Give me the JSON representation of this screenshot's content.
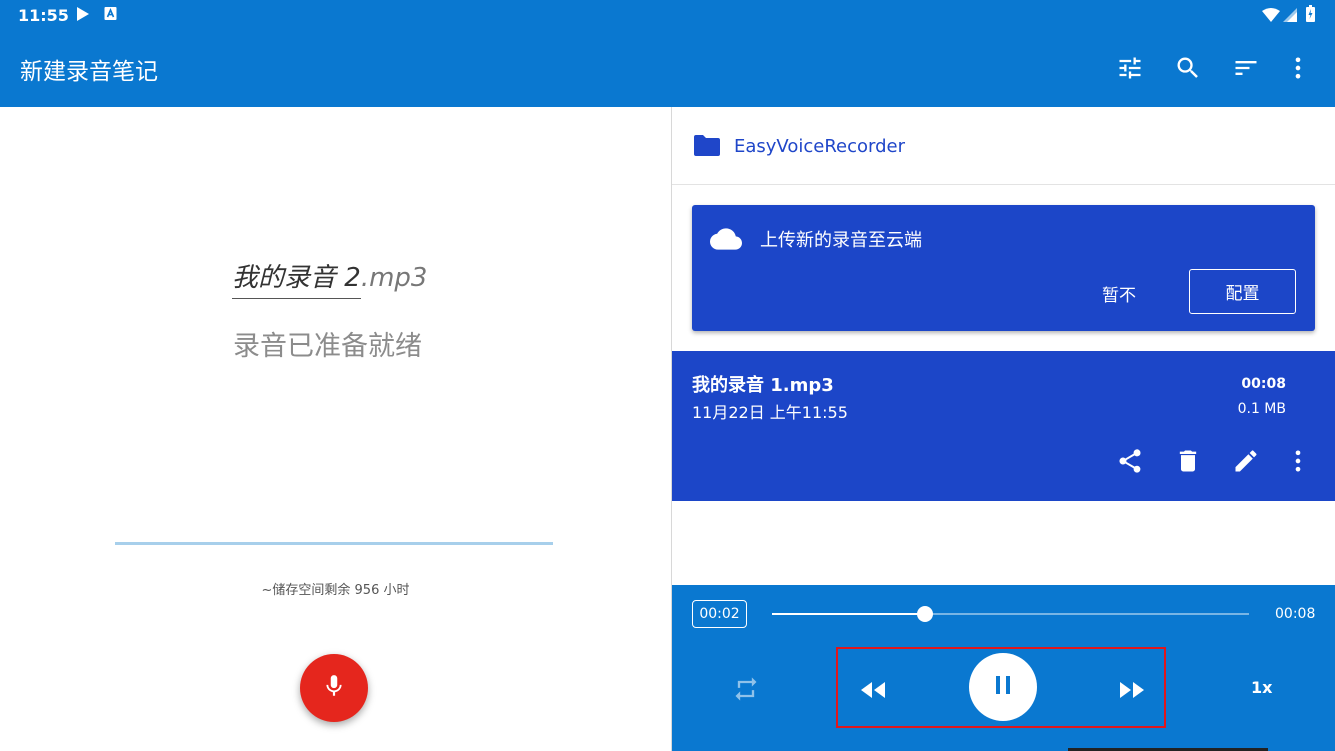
{
  "status_bar": {
    "time": "11:55",
    "icons": [
      "play-icon",
      "app-icon",
      "wifi-icon",
      "signal-icon",
      "battery-icon"
    ]
  },
  "app_bar": {
    "title": "新建录音笔记",
    "actions": [
      "tune-icon",
      "search-icon",
      "sort-icon",
      "more-vert-icon"
    ]
  },
  "recorder": {
    "file_base": "我的录音 2",
    "file_ext": ".mp3",
    "status": "录音已准备就绪",
    "storage": "~储存空间剩余 956 小时"
  },
  "folder": {
    "name": "EasyVoiceRecorder"
  },
  "cloud_card": {
    "message": "上传新的录音至云端",
    "later_label": "暂不",
    "config_label": "配置"
  },
  "recording": {
    "name": "我的录音 1.mp3",
    "date": "11月22日 上午11:55",
    "duration": "00:08",
    "size": "0.1 MB",
    "actions": [
      "share-icon",
      "delete-icon",
      "edit-icon",
      "more-vert-icon"
    ]
  },
  "player": {
    "current": "00:02",
    "total": "00:08",
    "progress_fraction": 0.32,
    "speed": "1x"
  },
  "colors": {
    "primary": "#0a78d0",
    "accent_dark": "#1c46c8",
    "record_red": "#e5261d",
    "highlight_red": "#e0161b"
  }
}
